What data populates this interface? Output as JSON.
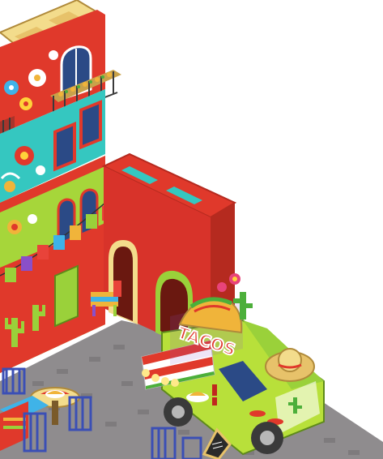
{
  "scene": {
    "truck_sign_text": "TACOS",
    "palette": {
      "wall_red": "#e0392b",
      "wall_teal": "#35c7c0",
      "wall_lime": "#a6d63a",
      "cobblestone": "#8f8c8e",
      "roof_cream": "#f3dc8c",
      "truck_green": "#b8e03a",
      "window_blue": "#2b4a86",
      "flag_colors": [
        "#e8433a",
        "#3fb3e8",
        "#9ad13a",
        "#8a4fc9",
        "#f0b43a"
      ]
    },
    "icons": [
      "building-icon",
      "balcony-icon",
      "flower-icon",
      "papel-picado-icon",
      "cactus-icon",
      "pinata-icon",
      "arch-doorway-icon",
      "taco-truck-icon",
      "taco-icon",
      "sombrero-icon",
      "chili-icon",
      "lantern-icon",
      "table-icon",
      "chair-icon",
      "menu-sign-icon"
    ]
  }
}
